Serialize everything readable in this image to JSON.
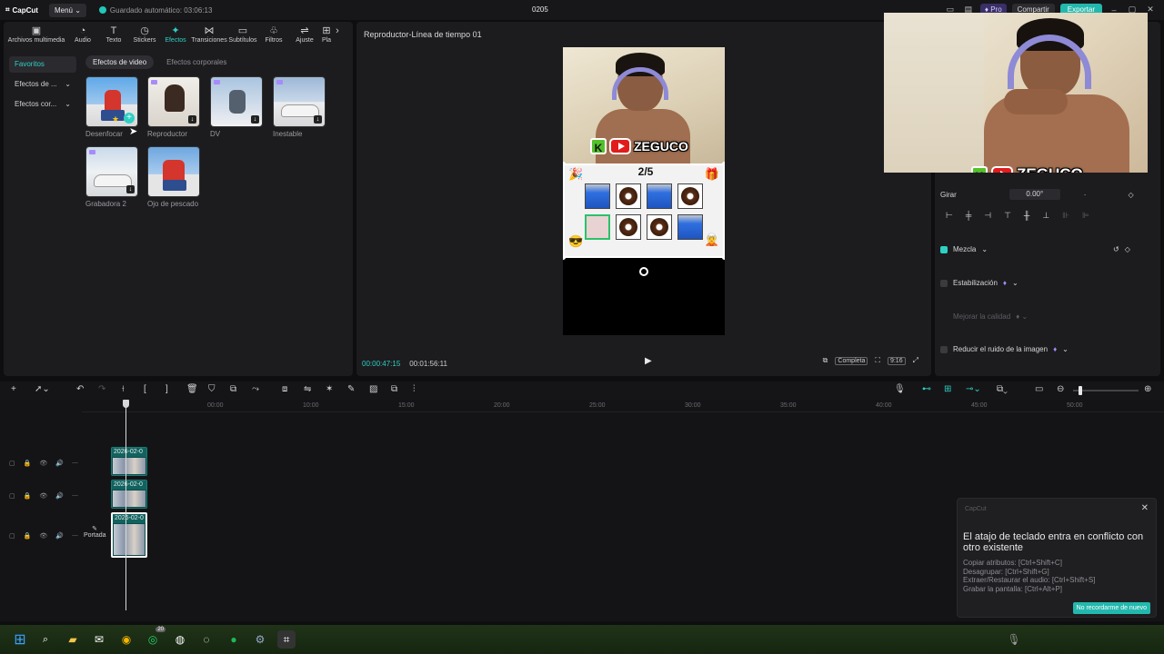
{
  "titlebar": {
    "app_name": "CapCut",
    "menu_label": "Menú",
    "autosave": "Guardado automático: 03:06:13",
    "project_name": "0205",
    "pro_label": "Pro",
    "share_label": "Compartir",
    "export_label": "Exportar"
  },
  "toolbar_tabs": [
    {
      "label": "Archivos multimedia",
      "icon": "media-icon"
    },
    {
      "label": "Audio",
      "icon": "audio-icon"
    },
    {
      "label": "Texto",
      "icon": "text-icon"
    },
    {
      "label": "Stickers",
      "icon": "sticker-icon"
    },
    {
      "label": "Efectos",
      "icon": "effects-icon",
      "active": true
    },
    {
      "label": "Transiciones",
      "icon": "transition-icon"
    },
    {
      "label": "Subtítulos",
      "icon": "subtitle-icon"
    },
    {
      "label": "Filtros",
      "icon": "filter-icon"
    },
    {
      "label": "Ajuste",
      "icon": "adjust-icon"
    },
    {
      "label": "Pla",
      "icon": "plugin-icon"
    }
  ],
  "sidebar": {
    "items": [
      {
        "label": "Favoritos"
      },
      {
        "label": "Efectos de ..."
      },
      {
        "label": "Efectos cor..."
      }
    ]
  },
  "subtabs": [
    "Efectos de video",
    "Efectos corporales"
  ],
  "effects": [
    {
      "label": "Desenfocar"
    },
    {
      "label": "Reproductor"
    },
    {
      "label": "DV"
    },
    {
      "label": "Inestable"
    },
    {
      "label": "Grabadora 2"
    },
    {
      "label": "Ojo de pescado"
    }
  ],
  "player": {
    "title": "Reproductor-Línea de tiempo 01",
    "brand_name": "ZEGUCO",
    "score": "2/5",
    "current_time": "00:00:47:15",
    "total_time": "00:01:56:11",
    "full_label": "Completa",
    "ratio_label": "9:16"
  },
  "props": {
    "rotate_label": "Girar",
    "rotate_value": "0.00°",
    "blend_label": "Mezcla",
    "stabilize_label": "Estabilización",
    "quality_label": "Mejorar la calidad",
    "noise_label": "Reducir el ruido de la imagen"
  },
  "timeline": {
    "ruler": [
      "00:00",
      "10:00",
      "15:00",
      "20:00",
      "25:00",
      "30:00",
      "35:00",
      "40:00",
      "45:00",
      "50:00"
    ],
    "clip_label": "2026-02-0",
    "cover_label": "Portada"
  },
  "toast": {
    "app": "CapCut",
    "title": "El atajo de teclado entra en conflicto con otro existente",
    "lines": [
      "Copiar atributos: [Ctrl+Shift+C]",
      "Desagrupar: [Ctrl+Shift+G]",
      "Extraer/Restaurar el audio: [Ctrl+Shift+S]",
      "Grabar la pantalla: [Ctrl+Alt+P]"
    ],
    "button": "No recordarme de nuevo"
  },
  "taskbar": {
    "whatsapp_badge": "20"
  }
}
